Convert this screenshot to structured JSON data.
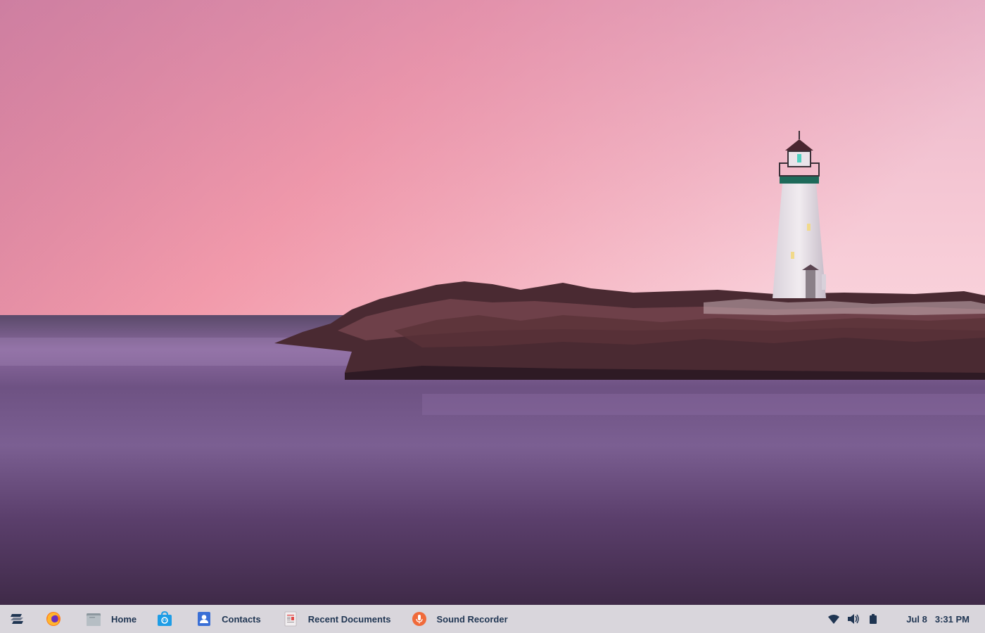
{
  "taskbar": {
    "apps": [
      {
        "name": "zorin-menu",
        "icon": "zorin-logo-icon",
        "label": ""
      },
      {
        "name": "firefox",
        "icon": "firefox-icon",
        "label": ""
      },
      {
        "name": "home",
        "icon": "folder-icon",
        "label": "Home"
      },
      {
        "name": "software",
        "icon": "software-store-icon",
        "label": ""
      },
      {
        "name": "contacts",
        "icon": "contacts-icon",
        "label": "Contacts"
      },
      {
        "name": "recent-documents",
        "icon": "documents-icon",
        "label": "Recent Documents"
      },
      {
        "name": "sound-recorder",
        "icon": "microphone-icon",
        "label": "Sound Recorder"
      }
    ],
    "tray": {
      "icons": [
        "wifi-icon",
        "volume-icon",
        "battery-icon"
      ],
      "date": "Jul 8",
      "time": "3:31 PM"
    }
  },
  "colors": {
    "taskbar_bg": "#d9d6dc",
    "taskbar_text": "#1f3552",
    "accent": "#2f6fd0"
  }
}
